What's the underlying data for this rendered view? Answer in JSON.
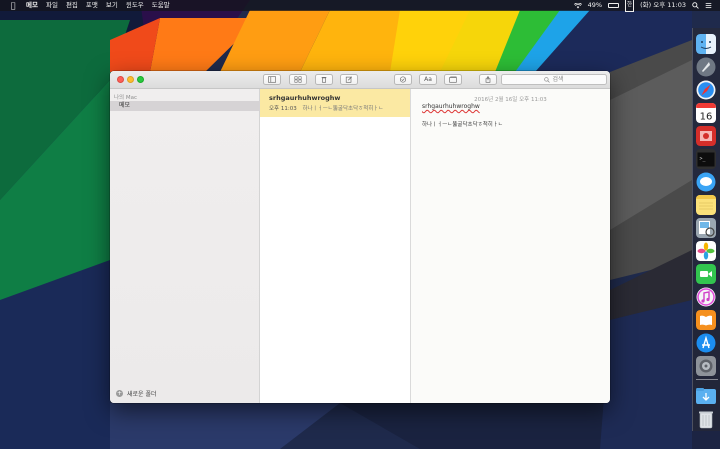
{
  "menubar": {
    "app_name": "메모",
    "items": [
      "파일",
      "편집",
      "포맷",
      "보기",
      "윈도우",
      "도움말"
    ],
    "battery": "49%",
    "input_indicator": "한",
    "clock": "(화) 오후 11:03"
  },
  "window": {
    "search_placeholder": "검색"
  },
  "sidebar": {
    "section_header": "나의 Mac",
    "folder": "메모",
    "new_folder_label": "새로운 폴더"
  },
  "notes_list": {
    "items": [
      {
        "title": "srhgaurhuhwroghw",
        "time": "오후 11:03",
        "snippet": "하나ㅣㅓㅡㄴ뚫굴닥초닥ㅎ척히ㅏㄴ"
      }
    ]
  },
  "editor": {
    "date": "2016년 2월 16일 오후 11:03",
    "title": "srhgaurhuhwroghw",
    "body": "하나ㅣㅓㅡㄴ뚫굴닥초닥ㅎ척히ㅏㄴ"
  },
  "dock": {
    "calendar_day": "16",
    "icons": [
      "finder-icon",
      "launchpad-icon",
      "safari-icon",
      "calendar-icon",
      "photo-booth-icon",
      "terminal-icon",
      "messages-icon",
      "notes-icon",
      "preview-icon",
      "photos-icon",
      "facetime-icon",
      "itunes-icon",
      "ibooks-icon",
      "app-store-icon",
      "system-preferences-icon",
      "downloads-folder-icon",
      "trash-icon"
    ]
  },
  "colors": {
    "note_highlight": "#fbe9a3",
    "sidebar_selection": "#d6d3d5",
    "close": "#fc5f57",
    "minimize": "#fdbc2e",
    "zoom": "#28c83f"
  }
}
